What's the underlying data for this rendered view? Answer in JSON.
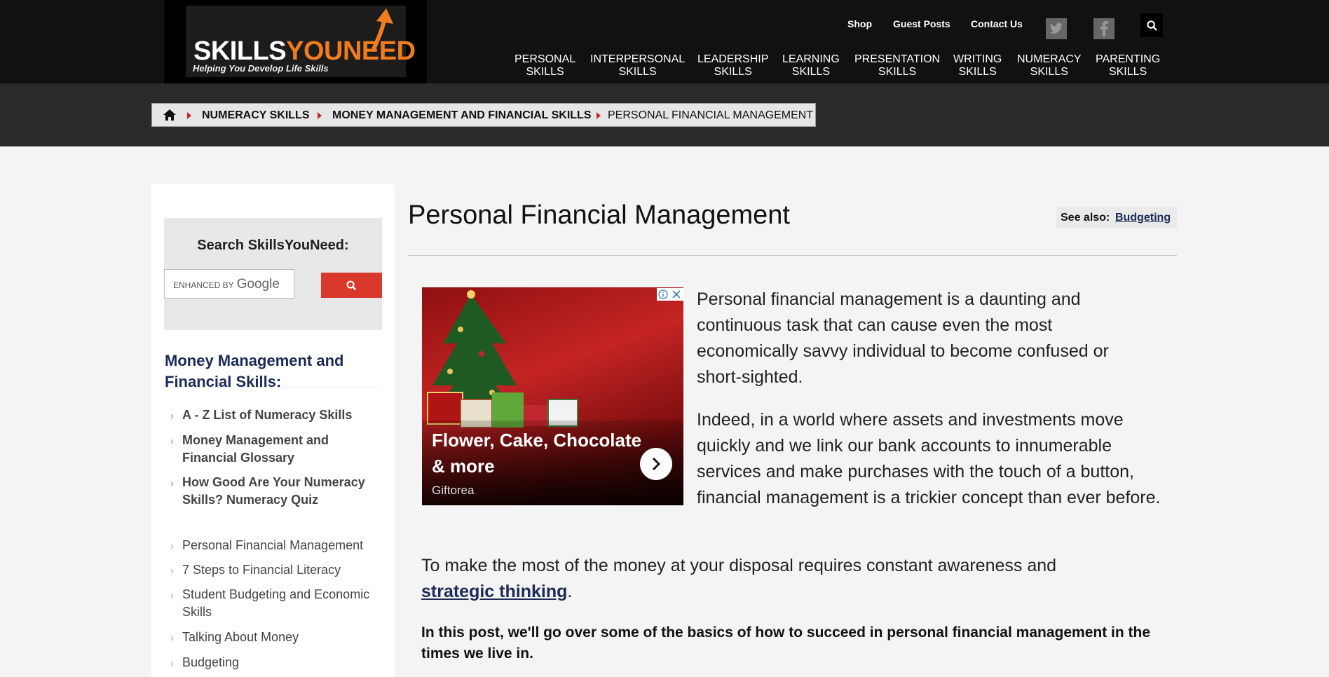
{
  "header": {
    "logo_main": "SKILLS",
    "logo_accent": "YOUNEED",
    "logo_tagline": "Helping You Develop Life Skills",
    "utility_links": [
      "Shop",
      "Guest Posts",
      "Contact Us"
    ],
    "nav": [
      [
        "PERSONAL",
        "SKILLS"
      ],
      [
        "INTERPERSONAL",
        "SKILLS"
      ],
      [
        "LEADERSHIP",
        "SKILLS"
      ],
      [
        "LEARNING",
        "SKILLS"
      ],
      [
        "PRESENTATION",
        "SKILLS"
      ],
      [
        "WRITING",
        "SKILLS"
      ],
      [
        "NUMERACY",
        "SKILLS"
      ],
      [
        "PARENTING",
        "SKILLS"
      ]
    ]
  },
  "breadcrumb": [
    "NUMERACY SKILLS",
    "MONEY MANAGEMENT AND FINANCIAL SKILLS",
    "PERSONAL FINANCIAL MANAGEMENT"
  ],
  "sidebar": {
    "search_title": "Search SkillsYouNeed:",
    "search_placeholder_prefix": "ENHANCED BY",
    "search_placeholder_brand": "Google",
    "section_heading": "Money Management and Financial Skills:",
    "items_bold": [
      "A - Z List of Numeracy Skills",
      "Money Management and Financial Glossary",
      "How Good Are Your Numeracy Skills? Numeracy Quiz"
    ],
    "items": [
      "Personal Financial Management",
      "7 Steps to Financial Literacy",
      "Student Budgeting and Economic Skills",
      "Talking About Money",
      "Budgeting"
    ]
  },
  "article": {
    "title": "Personal Financial Management",
    "see_also_label": "See also:",
    "see_also_link": "Budgeting",
    "ad": {
      "headline": "Flower, Cake, Chocolate & more",
      "brand": "Giftorea"
    },
    "p1": "Personal financial management is a daunting and continuous task that can cause even the most economically savvy individual to become confused or short-sighted.",
    "p2": "Indeed, in a world where assets and investments move quickly and we link our bank accounts to innumerable services and make purchases with the touch of a button, financial management is a trickier concept than ever before.",
    "p3_text": "To make the most of the money at your disposal requires constant awareness and",
    "p3_link": "strategic thinking",
    "p3_end": ".",
    "p4": "In this post, we'll go over some of the basics of how to succeed in personal financial management in the times we live in."
  },
  "colors": {
    "topbar": "#111111",
    "accent_orange": "#f07c1e",
    "link_navy": "#1c2b57",
    "search_red": "#d9392b",
    "crumb_arrow": "#c0262d"
  }
}
